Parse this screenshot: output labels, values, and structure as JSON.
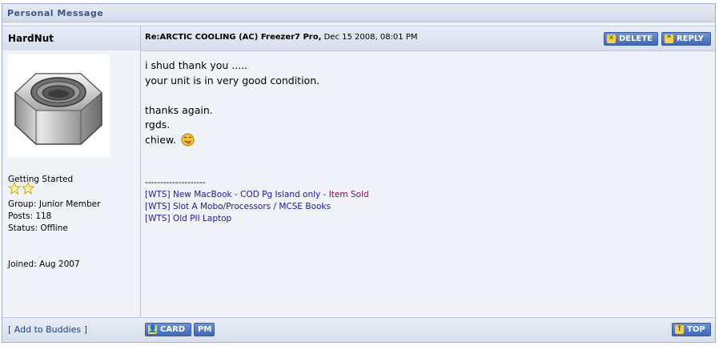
{
  "panel": {
    "title": "Personal Message"
  },
  "post": {
    "author": "HardNut",
    "subject": "Re:ARCTIC COOLING (AC) Freezer7 Pro,",
    "datetime": "Dec 15 2008, 08:01 PM",
    "actions": {
      "delete_label": "DELETE",
      "reply_label": "REPLY"
    }
  },
  "profile": {
    "rank_title": "Getting Started",
    "stars": 2,
    "group": "Group: Junior Member",
    "posts": "Posts: 118",
    "status": "Status: Offline",
    "joined": "Joined: Aug 2007",
    "add_buddy_label": "[ Add to Buddies ]"
  },
  "message": {
    "lines": [
      "i shud thank you .....",
      "your unit is in very good condition.",
      "",
      "thanks again.",
      "rgds.",
      "chiew."
    ]
  },
  "signature": {
    "separator": "--------------------",
    "link1_text": "[WTS] New MacBook - COD Pg Island only - ",
    "link1_sold": "Item Sold",
    "link2": "[WTS] Slot A Mobo/Processors / MCSE Books",
    "link3": "[WTS] Old PII Laptop"
  },
  "footer": {
    "card_label": "CARD",
    "pm_label": "PM",
    "top_label": "TOP"
  },
  "colors": {
    "button_blue": "#4a72bd",
    "panel_bg": "#f0f3f8",
    "header_text": "#3d5581"
  }
}
